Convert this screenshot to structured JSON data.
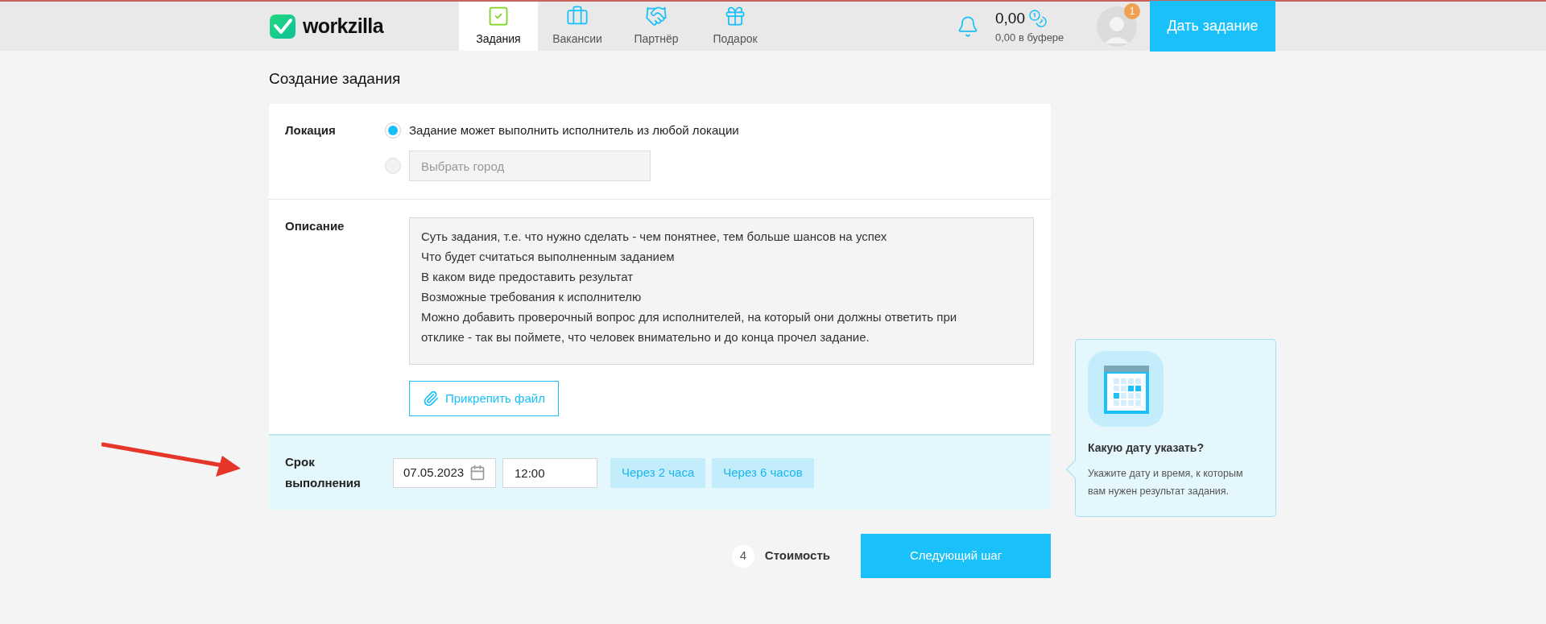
{
  "header": {
    "logo": "workzilla",
    "nav": [
      {
        "label": "Задания",
        "kind": "tasks",
        "selected": true
      },
      {
        "label": "Вакансии",
        "kind": "jobs",
        "selected": false
      },
      {
        "label": "Партнёр",
        "kind": "partner",
        "selected": false
      },
      {
        "label": "Подарок",
        "kind": "gift",
        "selected": false
      }
    ],
    "balance": "0,00",
    "buffer": "0,00 в буфере",
    "notification_count": "1",
    "cta": "Дать задание"
  },
  "page_title": "Создание задания",
  "location": {
    "label": "Локация",
    "options": [
      {
        "kind": "text",
        "label": "Задание может выполнить исполнитель из любой локации",
        "selected": true
      },
      {
        "kind": "field",
        "placeholder": "Выбрать город",
        "selected": false
      }
    ]
  },
  "description": {
    "label": "Описание",
    "lines": [
      "Суть задания, т.е. что нужно сделать - чем понятнее, тем больше шансов на успех",
      "Что будет считаться выполненным заданием",
      "В каком виде предоставить результат",
      "Возможные требования к исполнителю",
      "Можно добавить проверочный вопрос для исполнителей, на который они должны ответить при",
      "отклике - так вы поймете, что человек внимательно и до конца прочел задание."
    ],
    "attach": "Прикрепить файл"
  },
  "deadline": {
    "label": "Срок выполнения",
    "date": "07.05.2023",
    "time": "12:00",
    "quick": [
      "Через 2 часа",
      "Через 6 часов"
    ]
  },
  "hint": {
    "title": "Какую дату указать?",
    "text": "Укажите дату и время, к которым вам нужен результат задания."
  },
  "footer": {
    "step": "4",
    "step_label": "Стоимость",
    "next": "Следующий шаг"
  }
}
